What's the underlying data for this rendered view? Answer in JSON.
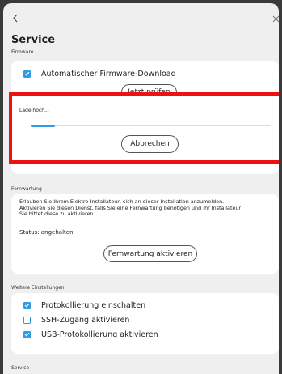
{
  "header": {
    "title": "Service"
  },
  "firmware": {
    "section_label": "Firmware",
    "auto_download_label": "Automatischer Firmware-Download",
    "auto_download_checked": true,
    "check_button_label": "Jetzt prüfen"
  },
  "upload": {
    "status_label": "Lade hoch...",
    "progress": 0.1,
    "cancel_label": "Abbrechen",
    "accent_color": "#ee1111"
  },
  "remote": {
    "section_label": "Fernwartung",
    "description_lines": [
      "Erlauben Sie Ihrem Elektro-Installateur, sich an dieser Installation anzumelden.",
      "Aktivieren Sie diesen Dienst, falls Sie eine Fernwartung benötigen und Ihr Installateur",
      "Sie bittet diese zu aktivieren."
    ],
    "status_text": "Status: angehalten",
    "activate_button_label": "Fernwartung aktivieren"
  },
  "more_settings": {
    "section_label": "Weitere Einstellungen",
    "items": [
      {
        "label": "Protokollierung einschalten",
        "checked": true
      },
      {
        "label": "SSH-Zugang aktivieren",
        "checked": false
      },
      {
        "label": "USB-Protokollierung aktivieren",
        "checked": true
      }
    ]
  },
  "service_footer": {
    "section_label": "Service"
  },
  "colors": {
    "accent": "#2d9be6",
    "background": "#efeff0",
    "card": "#ffffff"
  },
  "icons": {
    "back": "chevron-left-icon",
    "close": "close-icon",
    "checkbox": "check-icon"
  }
}
